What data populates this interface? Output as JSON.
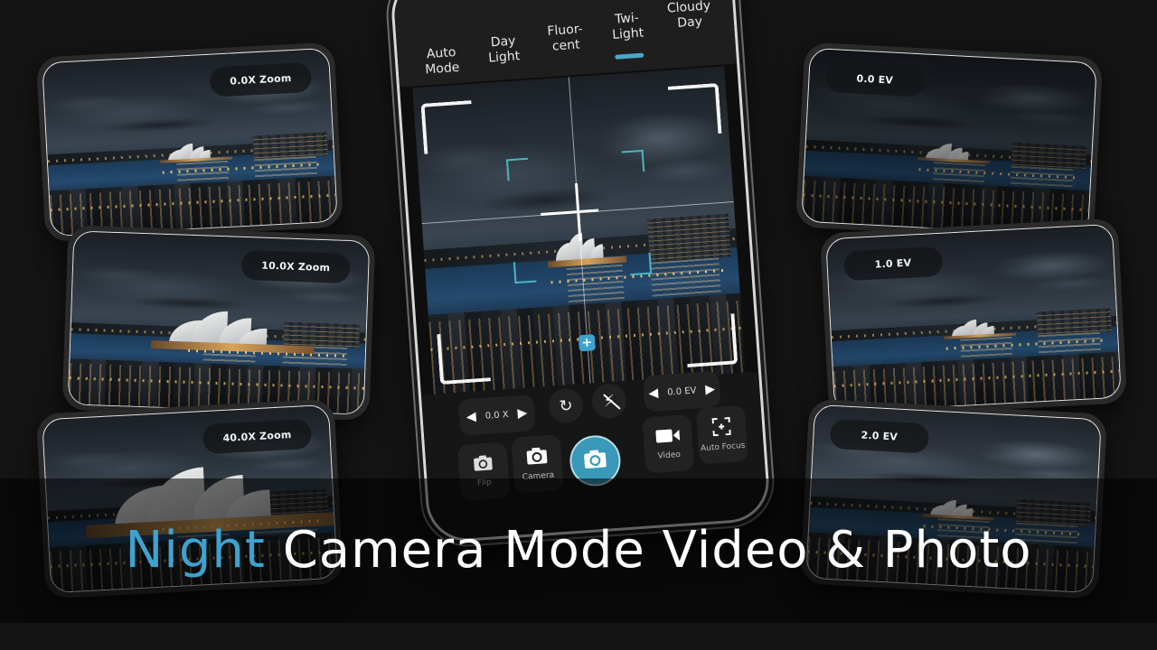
{
  "colors": {
    "background": "#141414",
    "accent": "#3ea2cf",
    "shutter": "#3a98b9",
    "focus_bracket": "#49b6c3",
    "headline_text": "#ffffff"
  },
  "zoom_cards": [
    {
      "label": "0.0X Zoom"
    },
    {
      "label": "10.0X Zoom"
    },
    {
      "label": "40.0X Zoom"
    }
  ],
  "ev_cards": [
    {
      "label": "0.0 EV"
    },
    {
      "label": "1.0 EV"
    },
    {
      "label": "2.0 EV"
    }
  ],
  "phone": {
    "white_balance_modes": [
      {
        "label": "Auto\nMode",
        "active": true
      },
      {
        "label": "Day\nLight",
        "active": false
      },
      {
        "label": "Fluor-\ncent",
        "active": false
      },
      {
        "label": "Twi-\nLight",
        "active": true
      },
      {
        "label": "Cloudy\nDay",
        "active": false
      }
    ],
    "zoom_stepper": {
      "value": "0.0 X",
      "left_icon": "triangle-left",
      "right_icon": "triangle-right"
    },
    "ev_stepper": {
      "value": "0.0 EV",
      "left_icon": "triangle-left",
      "right_icon": "triangle-right"
    },
    "icons": {
      "rotate": "↻",
      "flash_off": "⚡",
      "shutter": "camera",
      "plus": "+"
    },
    "tiles": {
      "flip": {
        "label": "Flip",
        "icon": "flip-camera"
      },
      "camera": {
        "label": "Camera",
        "icon": "camera"
      },
      "video": {
        "label": "Video",
        "icon": "video-camera"
      },
      "auto_focus": {
        "label": "Auto Focus",
        "icon": "focus-frame"
      }
    }
  },
  "headline": {
    "accent_word": "Night",
    "rest": " Camera Mode Video & Photo"
  }
}
